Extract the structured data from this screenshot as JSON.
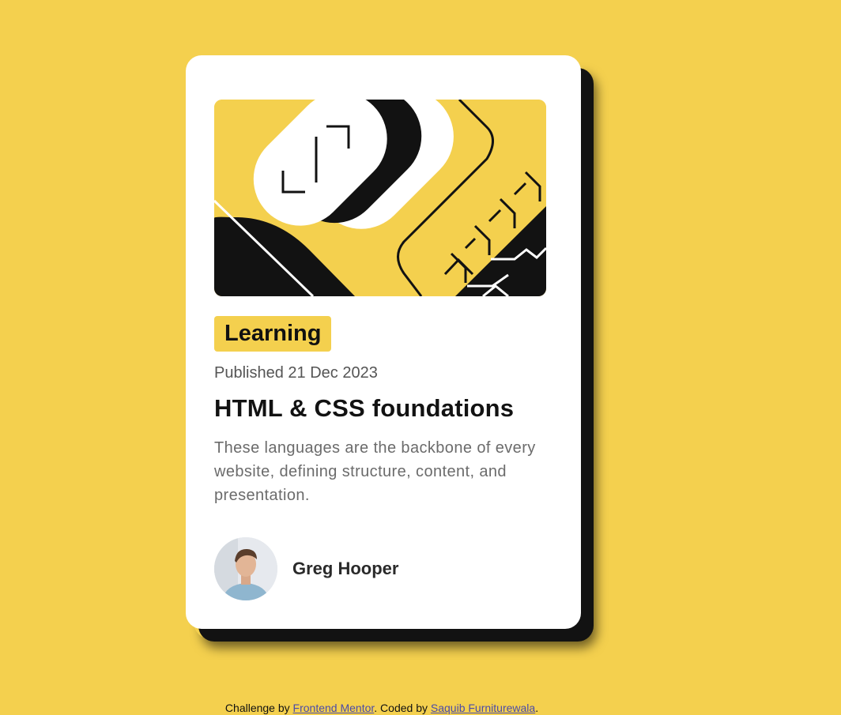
{
  "card": {
    "tag": "Learning",
    "published": "Published 21 Dec 2023",
    "title": "HTML & CSS foundations",
    "description": "These languages are the backbone of every website, defining structure, content, and presentation.",
    "author": "Greg Hooper",
    "hero_image_icon": "abstract-illustration-icon",
    "avatar_icon": "avatar-photo-icon"
  },
  "attribution": {
    "prefix": "Challenge by ",
    "link1": "Frontend Mentor",
    "middle": ". Coded by ",
    "link2": "Saquib Furniturewala",
    "suffix": "."
  },
  "colors": {
    "background": "#f4d04e",
    "card": "#ffffff",
    "text_dark": "#121212",
    "text_muted": "#6b6b6b",
    "shadow": "#121212"
  }
}
